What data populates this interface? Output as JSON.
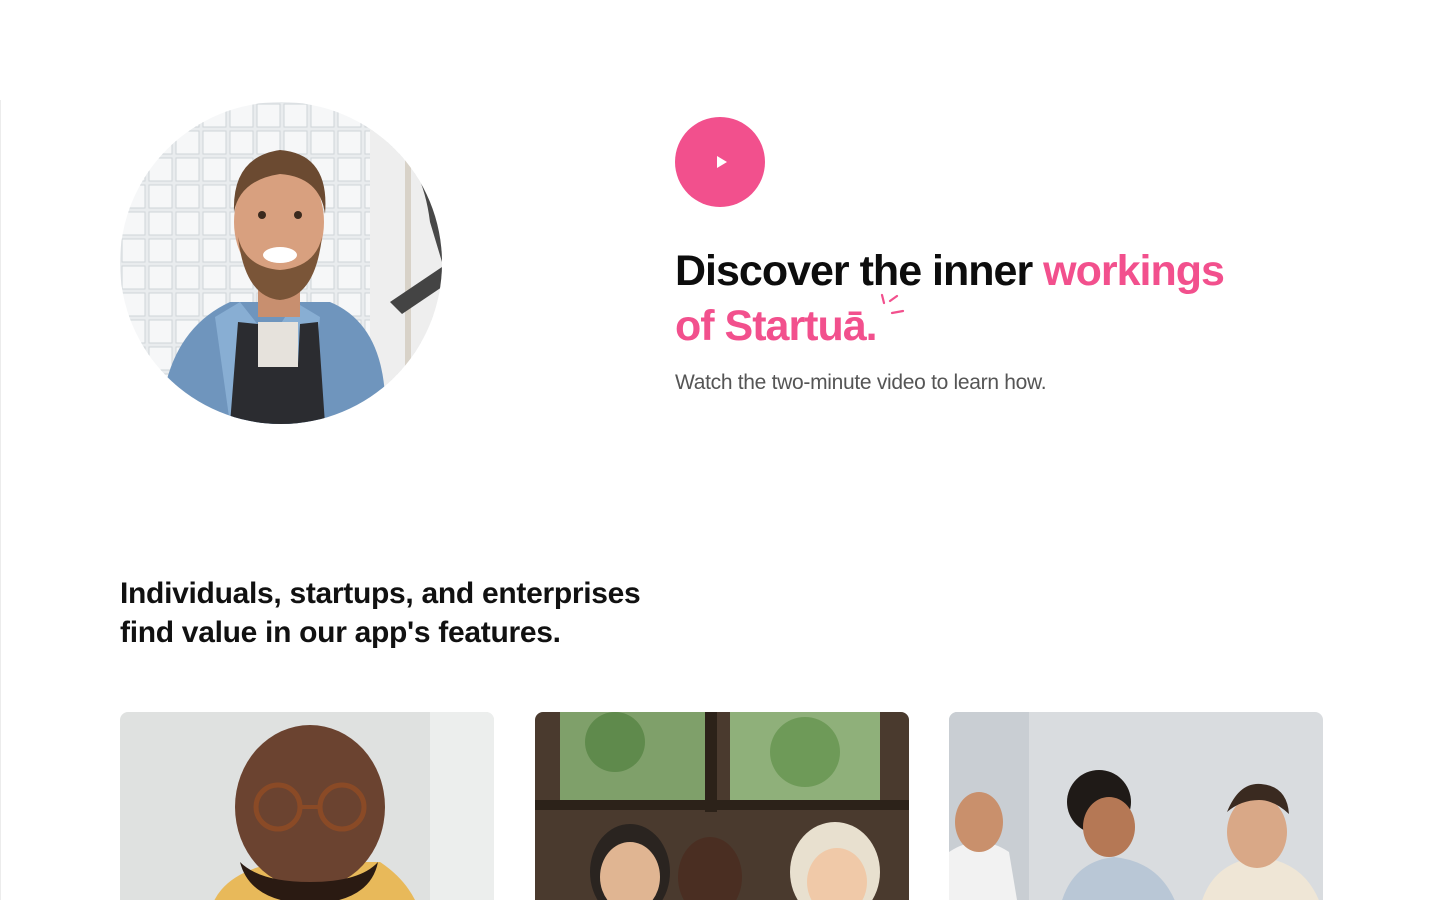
{
  "video_promo": {
    "headline_part1": "Discover the inner ",
    "headline_accent_1": "workings",
    "headline_accent_2": "of Startuā.",
    "subtitle": "Watch the two-minute video to learn how.",
    "play_icon": "play-icon",
    "accent_color": "#f2508d"
  },
  "portrait": {
    "subject": "smiling bearded man in denim shirt and black apron"
  },
  "audience": {
    "heading_line1": "Individuals, startups, and enterprises",
    "heading_line2": "find value in our app's features.",
    "cards": [
      {
        "image": "man with round tortoiseshell glasses"
      },
      {
        "image": "group of women working at a table by a window"
      },
      {
        "image": "team laughing together around a laptop"
      }
    ]
  }
}
